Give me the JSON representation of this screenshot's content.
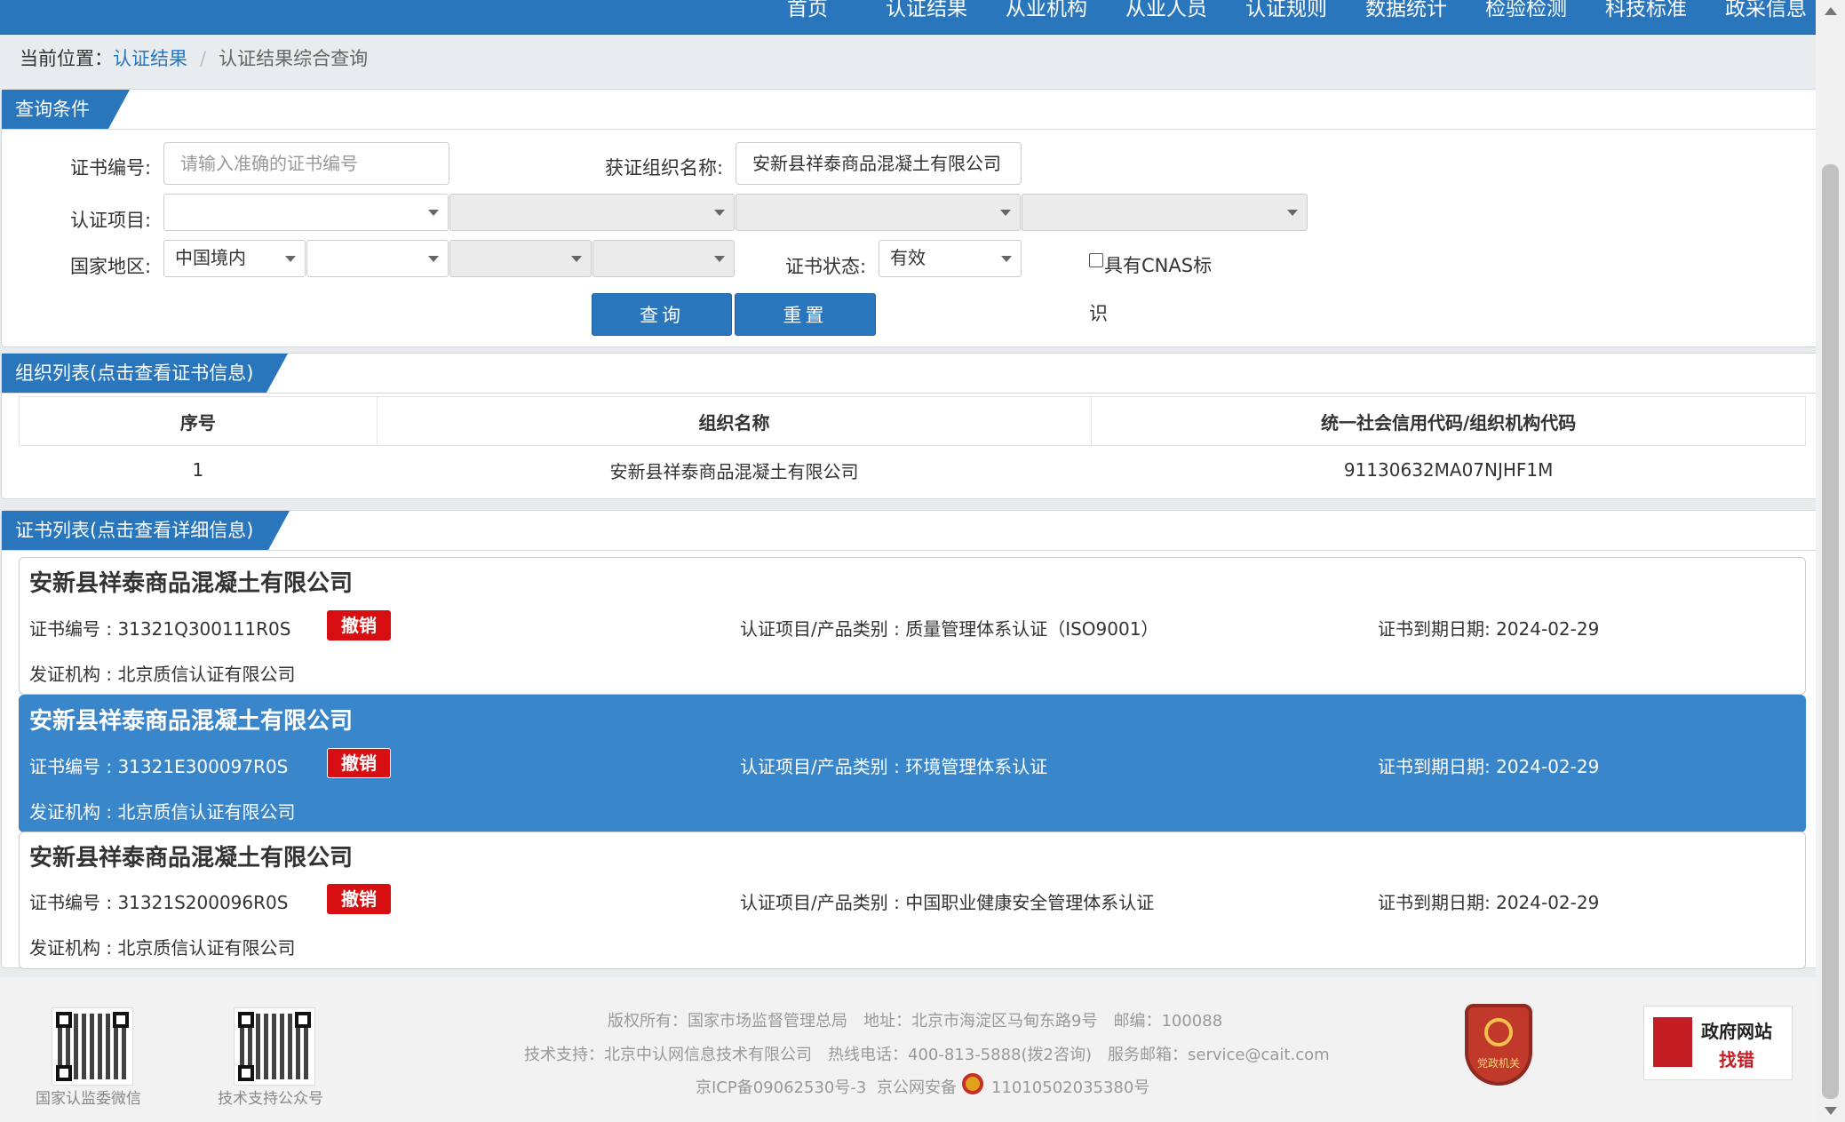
{
  "nav": [
    "首页",
    "认证结果",
    "从业机构",
    "从业人员",
    "认证规则",
    "数据统计",
    "检验检测",
    "科技标准",
    "政采信息"
  ],
  "breadcrumb": {
    "prefix": "当前位置：",
    "link": "认证结果",
    "current": "认证结果综合查询"
  },
  "query": {
    "title": "查询条件",
    "cert_no_label": "证书编号:",
    "cert_no_placeholder": "请输入准确的证书编号",
    "org_label": "获证组织名称:",
    "org_value": "安新县祥泰商品混凝土有限公司",
    "project_label": "认证项目:",
    "region_label": "国家地区:",
    "region_value": "中国境内",
    "status_label": "证书状态:",
    "status_value": "有效",
    "cnas_label_1": "具有CNAS标",
    "cnas_label_2": "识",
    "search_btn": "查询",
    "reset_btn": "重置"
  },
  "org_list": {
    "title": "组织列表(点击查看证书信息)",
    "headers": [
      "序号",
      "组织名称",
      "统一社会信用代码/组织机构代码"
    ],
    "rows": [
      [
        "1",
        "安新县祥泰商品混凝土有限公司",
        "91130632MA07NJHF1M"
      ]
    ]
  },
  "cert_list": {
    "title": "证书列表(点击查看详细信息)",
    "cards": [
      {
        "org": "安新县祥泰商品混凝土有限公司",
        "cert_no": "证书编号 : 31321Q300111R0S",
        "status": "撤销",
        "project": "认证项目/产品类别 : 质量管理体系认证（ISO9001）",
        "expiry": "证书到期日期: 2024-02-29",
        "issuer": "发证机构 : 北京质信认证有限公司"
      },
      {
        "org": "安新县祥泰商品混凝土有限公司",
        "cert_no": "证书编号 : 31321E300097R0S",
        "status": "撤销",
        "project": "认证项目/产品类别 : 环境管理体系认证",
        "expiry": "证书到期日期: 2024-02-29",
        "issuer": "发证机构 : 北京质信认证有限公司"
      },
      {
        "org": "安新县祥泰商品混凝土有限公司",
        "cert_no": "证书编号 : 31321S200096R0S",
        "status": "撤销",
        "project": "认证项目/产品类别 : 中国职业健康安全管理体系认证",
        "expiry": "证书到期日期: 2024-02-29",
        "issuer": "发证机构 : 北京质信认证有限公司"
      }
    ]
  },
  "footer": {
    "qr1_caption": "国家认监委微信",
    "qr2_caption": "技术支持公众号",
    "line1": "版权所有：国家市场监督管理总局　地址：北京市海淀区马甸东路9号　邮编：100088",
    "line2": "技术支持：北京中认网信息技术有限公司　热线电话：400-813-5888(拨2咨询)　服务邮箱：service@cait.com",
    "icp": "京ICP备09062530号-3",
    "police_prefix": "京公网安备",
    "police_no": "11010502035380号",
    "badge_text": "党政机关",
    "gov_text_1": "政府网站",
    "gov_text_2": "找错"
  }
}
